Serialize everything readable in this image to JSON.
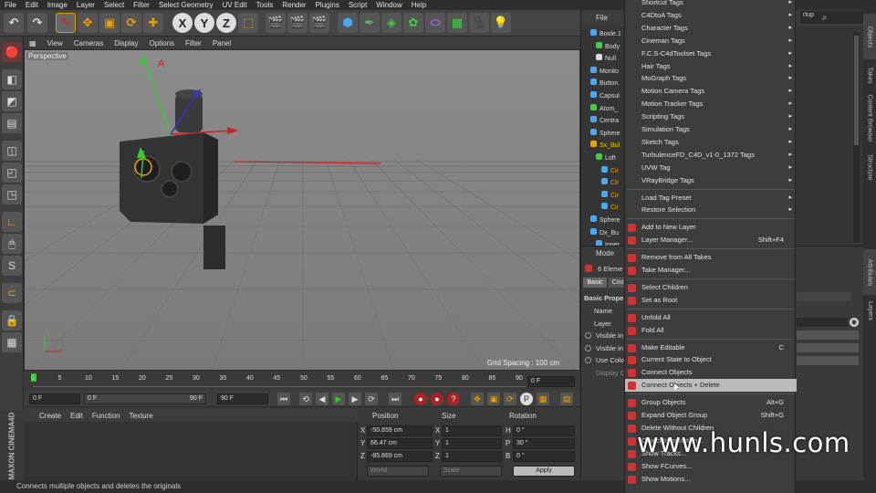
{
  "menubar": [
    "File",
    "Edit",
    "Image",
    "Layer",
    "Select",
    "Filter",
    "Select Geometry",
    "UV Edit",
    "Tools",
    "Render",
    "Plugins",
    "Script",
    "Window",
    "Help"
  ],
  "layout_dropdown": "rtup",
  "viewport": {
    "menu": [
      "View",
      "Cameras",
      "Display",
      "Options",
      "Filter",
      "Panel"
    ],
    "label": "Perspective",
    "grid_spacing": "Grid Spacing : 100 cm"
  },
  "timeline": {
    "ticks": [
      "0",
      "5",
      "10",
      "15",
      "20",
      "25",
      "30",
      "35",
      "40",
      "45",
      "50",
      "55",
      "60",
      "65",
      "70",
      "75",
      "80",
      "85",
      "90"
    ],
    "current_frame": "0 F",
    "start_field": "0 F",
    "range_start": "0 F",
    "range_end": "90 F",
    "end_field": "90 F"
  },
  "material_menu": [
    "Create",
    "Edit",
    "Function",
    "Texture"
  ],
  "coordinates": {
    "headers": [
      "Position",
      "Size",
      "Rotation"
    ],
    "rows": [
      {
        "axis": "X",
        "pos": "-50.859 cm",
        "size_axis": "X",
        "size": "1",
        "rot_axis": "H",
        "rot": "0 °"
      },
      {
        "axis": "Y",
        "pos": "66.47 cm",
        "size_axis": "Y",
        "size": "1",
        "rot_axis": "P",
        "rot": "30 °"
      },
      {
        "axis": "Z",
        "pos": "-85.869 cm",
        "size_axis": "Z",
        "size": "1",
        "rot_axis": "B",
        "rot": "0 °"
      }
    ],
    "world": "World",
    "scale": "Scale",
    "apply": "Apply"
  },
  "brand": "MAXON CINEMA4D",
  "status": "Connects multiple objects and deletes the originals",
  "objects": {
    "menu": [
      "File"
    ],
    "rows": [
      "Boole.1",
      "Body",
      "Null",
      "Monito",
      "Button",
      "Capsul",
      "Atom_",
      "Centra",
      "Sphere",
      "Sx_Bul",
      "Loft",
      "Cir",
      "Cir",
      "Cir",
      "Cir",
      "Sphere",
      "Dx_Bu",
      "Inner"
    ]
  },
  "attributes": {
    "mode": "Mode",
    "elements": "6 Eleme",
    "tabs": [
      "Basic",
      "Coo"
    ],
    "section": "Basic Prope",
    "fields": [
      "Name",
      "Layer",
      "Visible in",
      "Visible in",
      "Use Colo",
      "Display C"
    ]
  },
  "side_tabs": [
    "Objects",
    "Takes",
    "Content Browser",
    "Structure",
    "Attributes",
    "Layers"
  ],
  "context_menu": [
    {
      "label": "Shortcut Tags",
      "arrow": true
    },
    {
      "label": "C4DtoA Tags",
      "arrow": true
    },
    {
      "label": "Character Tags",
      "arrow": true
    },
    {
      "label": "Cineman Tags",
      "arrow": true
    },
    {
      "label": "F.C.S-C4dToolset Tags",
      "arrow": true
    },
    {
      "label": "Hair Tags",
      "arrow": true
    },
    {
      "label": "MoGraph Tags",
      "arrow": true
    },
    {
      "label": "Motion Camera Tags",
      "arrow": true
    },
    {
      "label": "Motion Tracker Tags",
      "arrow": true
    },
    {
      "label": "Scripting Tags",
      "arrow": true
    },
    {
      "label": "Simulation Tags",
      "arrow": true
    },
    {
      "label": "Sketch Tags",
      "arrow": true
    },
    {
      "label": "TurbulenceFD_C4D_v1-0_1372 Tags",
      "arrow": true
    },
    {
      "label": "UVW Tag",
      "arrow": true
    },
    {
      "label": "VRayBridge Tags",
      "arrow": true
    },
    {
      "sep": true
    },
    {
      "label": "Load Tag Preset",
      "arrow": true
    },
    {
      "label": "Restore Selection",
      "arrow": true
    },
    {
      "sep": true
    },
    {
      "label": "Add to New Layer",
      "icon": "#c33"
    },
    {
      "label": "Layer Manager...",
      "shortcut": "Shift+F4",
      "icon": "#c33"
    },
    {
      "sep": true
    },
    {
      "label": "Remove from All Takes",
      "icon": "#c33"
    },
    {
      "label": "Take Manager...",
      "icon": "#c33"
    },
    {
      "sep": true
    },
    {
      "label": "Select Children",
      "icon": "#c33"
    },
    {
      "label": "Set as Root",
      "icon": "#c33"
    },
    {
      "sep": true
    },
    {
      "label": "Unfold All",
      "icon": "#c33"
    },
    {
      "label": "Fold All",
      "icon": "#c33"
    },
    {
      "sep": true
    },
    {
      "label": "Make Editable",
      "shortcut": "C",
      "icon": "#c33"
    },
    {
      "label": "Current State to Object",
      "icon": "#c33"
    },
    {
      "label": "Connect Objects",
      "icon": "#c33"
    },
    {
      "label": "Connect Objects + Delete",
      "highlight": true,
      "icon": "#c33"
    },
    {
      "sep": true
    },
    {
      "label": "Group Objects",
      "shortcut": "Alt+G",
      "icon": "#c33"
    },
    {
      "label": "Expand Object Group",
      "shortcut": "Shift+G",
      "icon": "#c33"
    },
    {
      "label": "Delete Without Children",
      "icon": "#c33"
    },
    {
      "label": "Object Information...",
      "icon": "#c33"
    },
    {
      "label": "Show Tracks...",
      "icon": "#c33"
    },
    {
      "label": "Show FCurves...",
      "icon": "#c33"
    },
    {
      "label": "Show Motions...",
      "icon": "#c33"
    }
  ],
  "watermark": "www.hunls.com"
}
